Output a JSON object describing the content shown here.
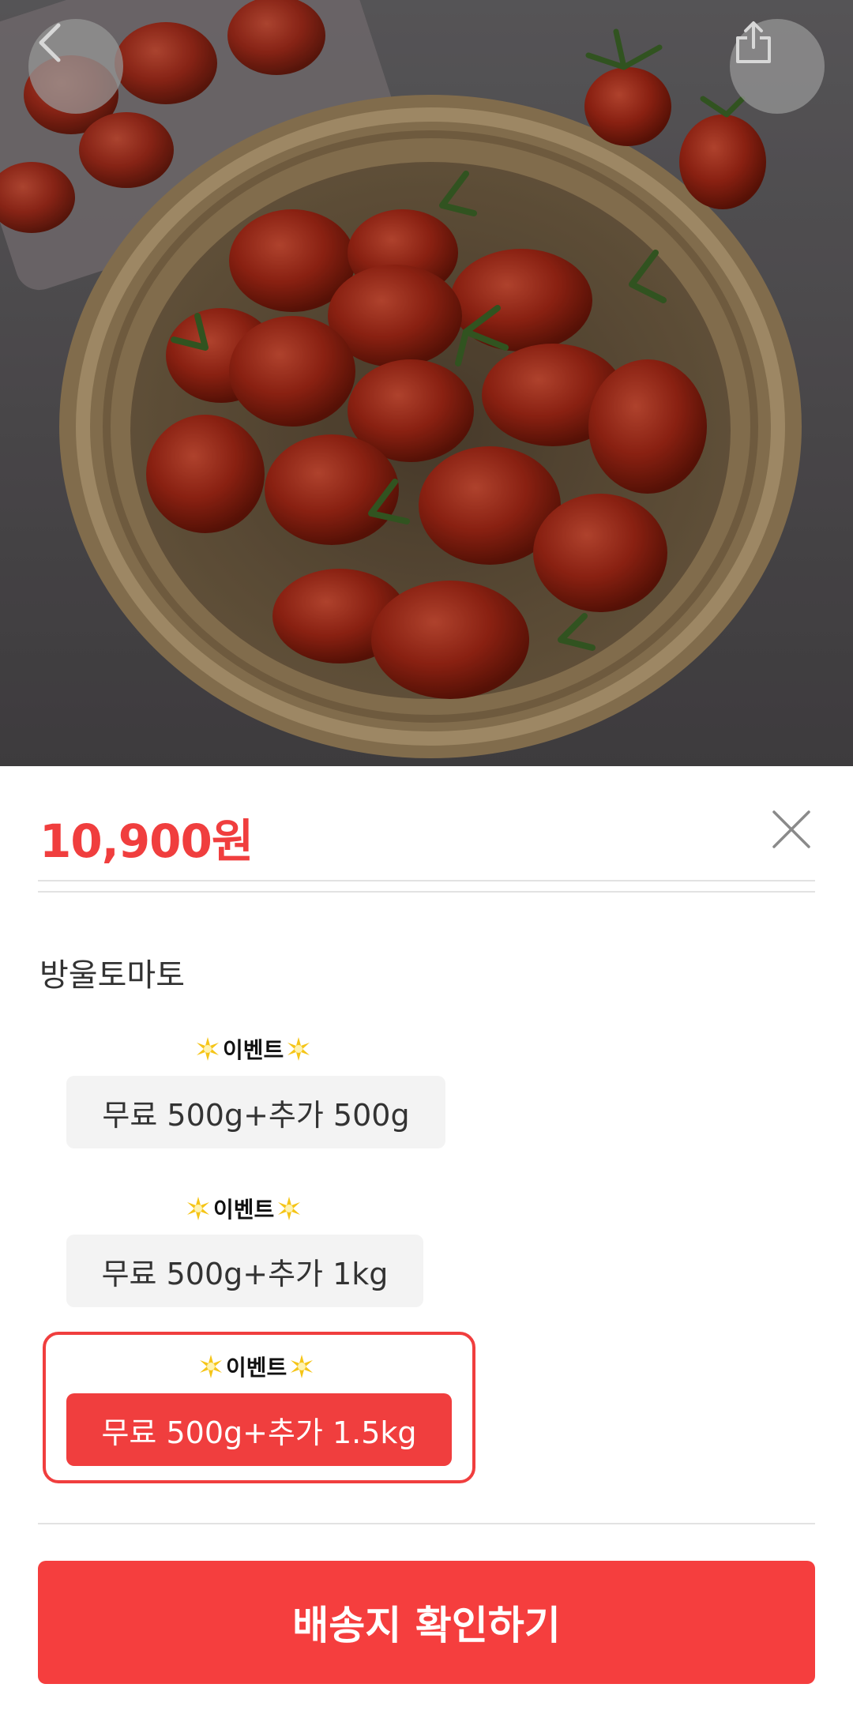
{
  "header": {
    "back_icon": "chevron-left-icon",
    "share_icon": "share-icon"
  },
  "product": {
    "price": "10,900원",
    "option_section_label": "방울토마토"
  },
  "options": [
    {
      "event_tag": "이벤트",
      "label": "무료 500g+추가 500g",
      "selected": false
    },
    {
      "event_tag": "이벤트",
      "label": "무료 500g+추가 1kg",
      "selected": false
    },
    {
      "event_tag": "이벤트",
      "label": "무료 500g+추가 1.5kg",
      "selected": true
    }
  ],
  "actions": {
    "close_icon": "close-icon",
    "confirm_label": "배송지 확인하기"
  },
  "colors": {
    "accent": "#f03e3e",
    "option_bg": "#f3f3f3",
    "event_star": "#f5c518"
  }
}
